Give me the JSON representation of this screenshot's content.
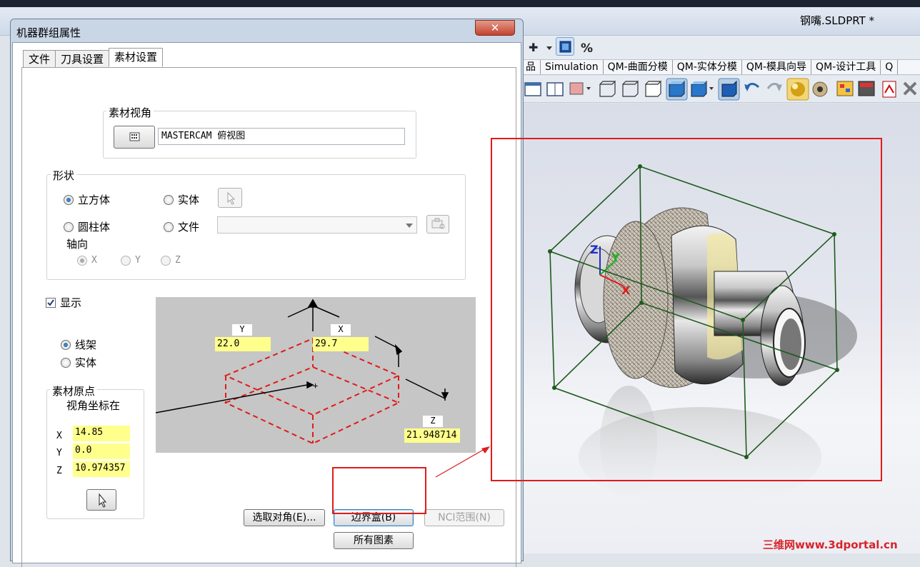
{
  "app": {
    "title": "钢嘴.SLDPRT *",
    "tabs": [
      "品",
      "Simulation",
      "QM-曲面分模",
      "QM-实体分模",
      "QM-模具向导",
      "QM-设计工具",
      "Q"
    ]
  },
  "dialog": {
    "title": "机器群组属性",
    "close_label": "✕",
    "tabs": [
      "文件",
      "刀具设置",
      "素材设置"
    ],
    "active_tab": "素材设置",
    "view_group": {
      "label": "素材视角",
      "view_value": "MASTERCAM 俯视图",
      "button_icon": "calculator-icon"
    },
    "shape_group": {
      "label": "形状",
      "cube": "立方体",
      "solid": "实体",
      "cylinder": "圆柱体",
      "file": "文件",
      "axis_label": "轴向",
      "axis_x": "X",
      "axis_y": "Y",
      "axis_z": "Z",
      "selected": "立方体"
    },
    "display": {
      "label": "显示",
      "checked": true,
      "wireframe": "线架",
      "solid": "实体",
      "selected": "线架"
    },
    "origin_group": {
      "label": "素材原点",
      "subtitle": "视角坐标在",
      "x_label": "X",
      "x_value": "14.85",
      "y_label": "Y",
      "y_value": "0.0",
      "z_label": "Z",
      "z_value": "10.974357"
    },
    "diagram": {
      "y_tag": "Y",
      "y_value": "22.0",
      "x_tag": "X",
      "x_value": "29.7",
      "z_tag": "Z",
      "z_value": "21.948714"
    },
    "buttons": {
      "select_corner": "选取对角(E)...",
      "bounding_box": "边界盒(B)",
      "nci_range": "NCI范围(N)",
      "all_entities": "所有图素"
    }
  },
  "watermark": "三维网www.3dportal.cn",
  "colors": {
    "highlight_red": "#e01b1b",
    "bounding_box_green": "#1f5a1f",
    "field_yellow": "#ffff8c"
  }
}
